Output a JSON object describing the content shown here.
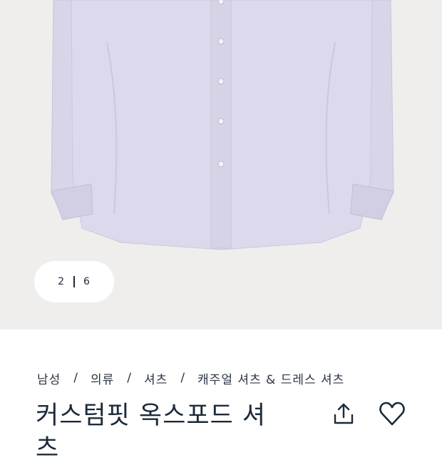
{
  "gallery": {
    "current_index": "2",
    "total_count": "6"
  },
  "breadcrumb": {
    "items": [
      "남성",
      "의류",
      "셔츠",
      "캐주얼 셔츠 & 드레스 셔츠"
    ]
  },
  "product": {
    "title": "커스텀핏 옥스포드 셔츠"
  },
  "icons": {
    "share": "share-icon",
    "favorite": "heart-icon"
  },
  "colors": {
    "shirt": "#d9d6ea",
    "background": "#efeeec",
    "text": "#1c2a3a"
  }
}
